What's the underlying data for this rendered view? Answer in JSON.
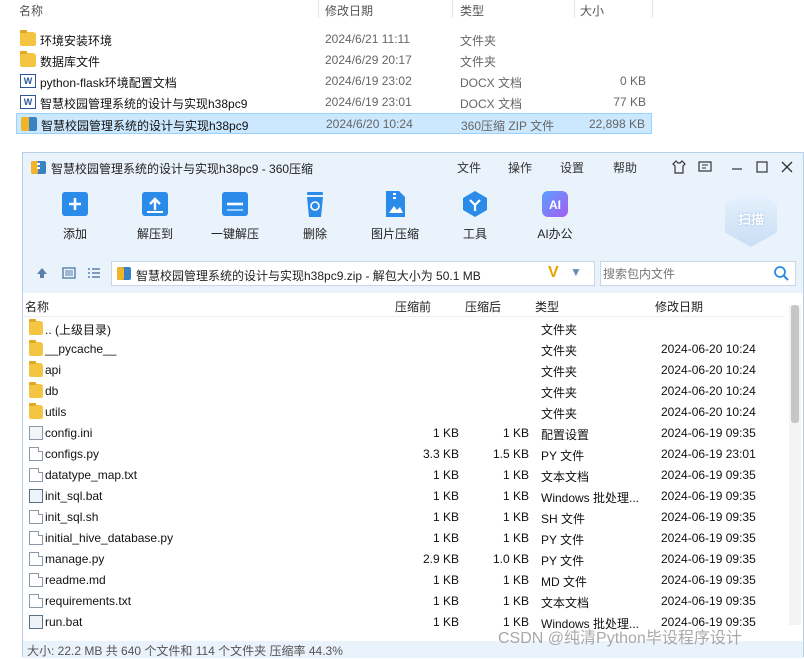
{
  "explorer": {
    "columns": {
      "name": "名称",
      "date": "修改日期",
      "type": "类型",
      "size": "大小"
    },
    "rows": [
      {
        "name": "环境安装环境",
        "date": "2024/6/21 11:11",
        "type": "文件夹",
        "size": "",
        "icon": "folder-icon",
        "selected": false
      },
      {
        "name": "数据库文件",
        "date": "2024/6/29 20:17",
        "type": "文件夹",
        "size": "",
        "icon": "folder-icon",
        "selected": false
      },
      {
        "name": "python-flask环境配置文档",
        "date": "2024/6/19 23:02",
        "type": "DOCX 文档",
        "size": "0 KB",
        "icon": "word-doc-icon",
        "selected": false
      },
      {
        "name": "智慧校园管理系统的设计与实现h38pc9",
        "date": "2024/6/19 23:01",
        "type": "DOCX 文档",
        "size": "77 KB",
        "icon": "word-doc-icon",
        "selected": false
      },
      {
        "name": "智慧校园管理系统的设计与实现h38pc9",
        "date": "2024/6/20 10:24",
        "type": "360压缩 ZIP 文件",
        "size": "22,898 KB",
        "icon": "zip-archive-icon",
        "selected": true
      }
    ]
  },
  "window": {
    "title": "智慧校园管理系统的设计与实现h38pc9 - 360压缩",
    "menu": [
      "文件",
      "操作",
      "设置",
      "帮助"
    ],
    "toolbar": [
      {
        "label": "添加",
        "icon": "add-icon",
        "color": "#2a8be8"
      },
      {
        "label": "解压到",
        "icon": "extract-to-icon",
        "color": "#2a8be8"
      },
      {
        "label": "一键解压",
        "icon": "one-click-extract-icon",
        "color": "#2a8be8"
      },
      {
        "label": "删除",
        "icon": "trash-icon",
        "color": "#2a8be8"
      },
      {
        "label": "图片压缩",
        "icon": "image-compress-icon",
        "color": "#2a8be8"
      },
      {
        "label": "工具",
        "icon": "tools-icon",
        "color": "#2a8be8"
      },
      {
        "label": "AI办公",
        "icon": "ai-office-icon",
        "color": "#7b4fe0"
      }
    ],
    "scan_label": "扫描",
    "path": "智慧校园管理系统的设计与实现h38pc9.zip - 解包大小为 50.1 MB",
    "search_placeholder": "搜索包内文件",
    "columns": {
      "name": "名称",
      "before": "压缩前",
      "after": "压缩后",
      "type": "类型",
      "modified": "修改日期"
    },
    "files": [
      {
        "name": ".. (上级目录)",
        "before": "",
        "after": "",
        "type": "文件夹",
        "modified": "",
        "icon": "folder-icon"
      },
      {
        "name": "__pycache__",
        "before": "",
        "after": "",
        "type": "文件夹",
        "modified": "2024-06-20 10:24",
        "icon": "folder-icon"
      },
      {
        "name": "api",
        "before": "",
        "after": "",
        "type": "文件夹",
        "modified": "2024-06-20 10:24",
        "icon": "folder-icon"
      },
      {
        "name": "db",
        "before": "",
        "after": "",
        "type": "文件夹",
        "modified": "2024-06-20 10:24",
        "icon": "folder-icon"
      },
      {
        "name": "utils",
        "before": "",
        "after": "",
        "type": "文件夹",
        "modified": "2024-06-20 10:24",
        "icon": "folder-icon"
      },
      {
        "name": "config.ini",
        "before": "1 KB",
        "after": "1 KB",
        "type": "配置设置",
        "modified": "2024-06-19 09:35",
        "icon": "config-file-icon"
      },
      {
        "name": "configs.py",
        "before": "3.3 KB",
        "after": "1.5 KB",
        "type": "PY 文件",
        "modified": "2024-06-19 23:01",
        "icon": "file-icon"
      },
      {
        "name": "datatype_map.txt",
        "before": "1 KB",
        "after": "1 KB",
        "type": "文本文档",
        "modified": "2024-06-19 09:35",
        "icon": "file-icon"
      },
      {
        "name": "init_sql.bat",
        "before": "1 KB",
        "after": "1 KB",
        "type": "Windows 批处理...",
        "modified": "2024-06-19 09:35",
        "icon": "batch-file-icon"
      },
      {
        "name": "init_sql.sh",
        "before": "1 KB",
        "after": "1 KB",
        "type": "SH 文件",
        "modified": "2024-06-19 09:35",
        "icon": "file-icon"
      },
      {
        "name": "initial_hive_database.py",
        "before": "1 KB",
        "after": "1 KB",
        "type": "PY 文件",
        "modified": "2024-06-19 09:35",
        "icon": "file-icon"
      },
      {
        "name": "manage.py",
        "before": "2.9 KB",
        "after": "1.0 KB",
        "type": "PY 文件",
        "modified": "2024-06-19 09:35",
        "icon": "file-icon"
      },
      {
        "name": "readme.md",
        "before": "1 KB",
        "after": "1 KB",
        "type": "MD 文件",
        "modified": "2024-06-19 09:35",
        "icon": "file-icon"
      },
      {
        "name": "requirements.txt",
        "before": "1 KB",
        "after": "1 KB",
        "type": "文本文档",
        "modified": "2024-06-19 09:35",
        "icon": "file-icon"
      },
      {
        "name": "run.bat",
        "before": "1 KB",
        "after": "1 KB",
        "type": "Windows 批处理...",
        "modified": "2024-06-19 09:35",
        "icon": "batch-file-icon"
      }
    ],
    "status": "大小: 22.2 MB 共 640 个文件和 114 个文件夹 压缩率 44.3%"
  },
  "watermark": "CSDN @纯清Python毕设程序设计"
}
